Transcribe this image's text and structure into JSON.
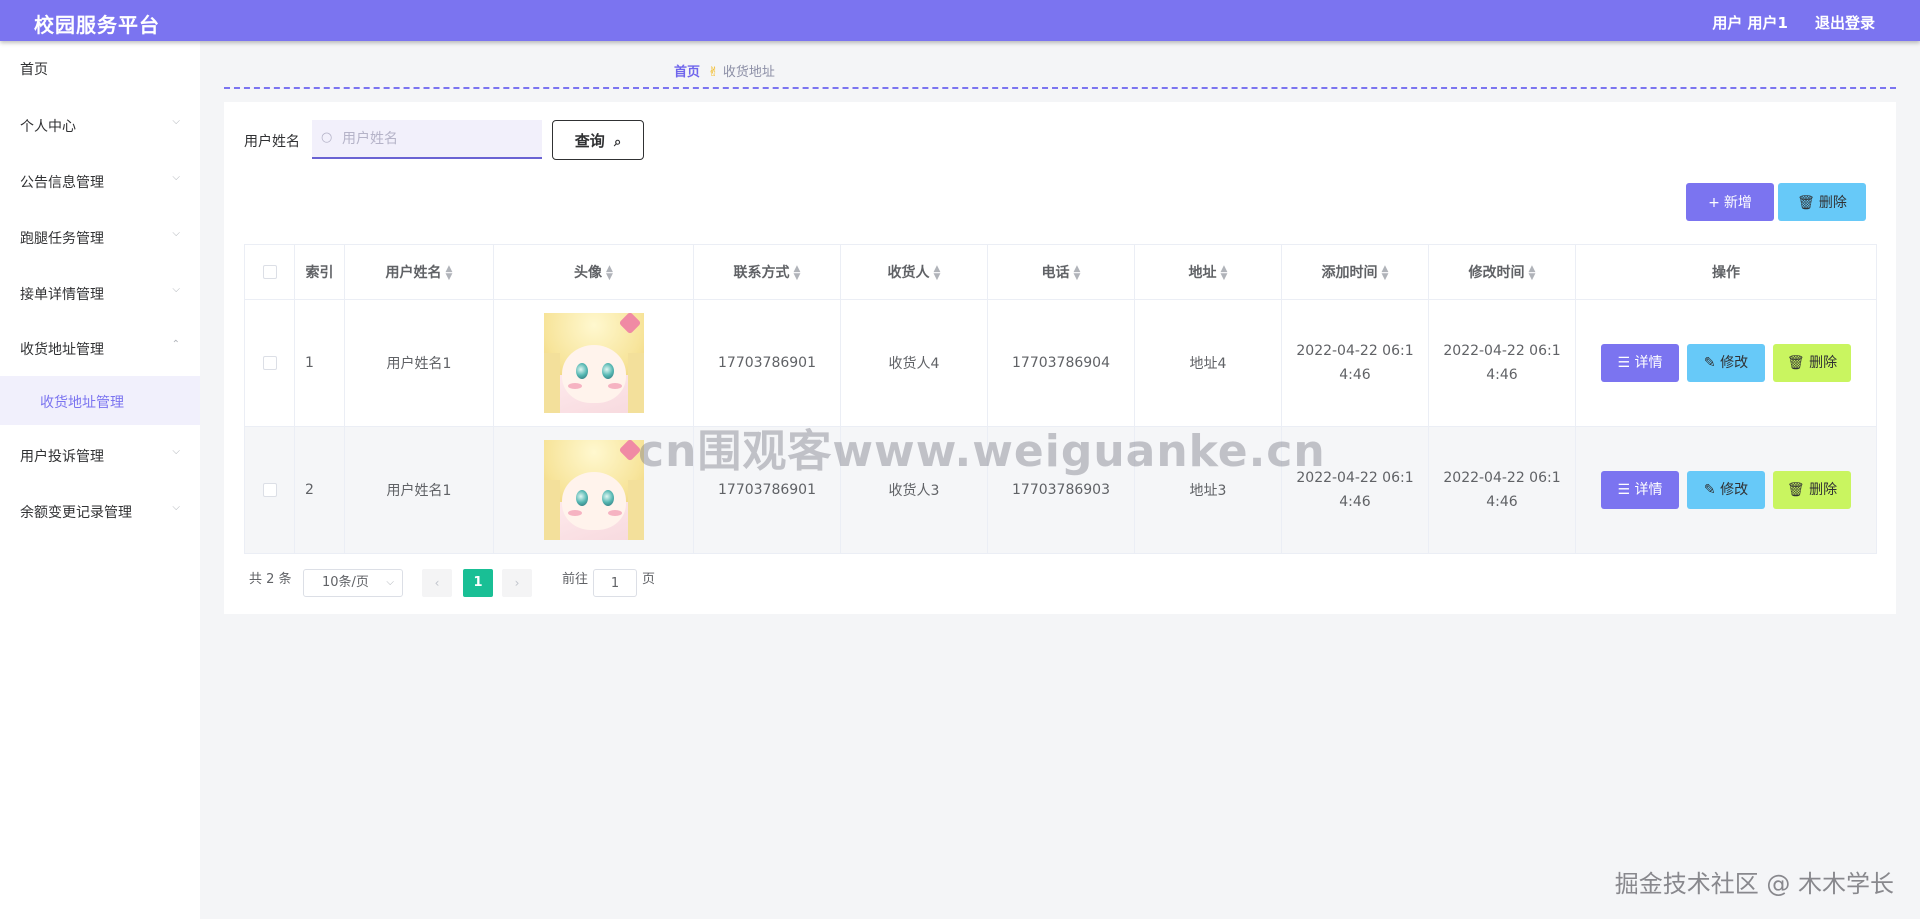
{
  "header": {
    "app_title": "校园服务平台",
    "user_label": "用户 用户1",
    "logout_label": "退出登录"
  },
  "sidebar": {
    "items": [
      {
        "label": "首页",
        "expandable": false
      },
      {
        "label": "个人中心",
        "expandable": true,
        "expanded": false
      },
      {
        "label": "公告信息管理",
        "expandable": true,
        "expanded": false
      },
      {
        "label": "跑腿任务管理",
        "expandable": true,
        "expanded": false
      },
      {
        "label": "接单详情管理",
        "expandable": true,
        "expanded": false
      },
      {
        "label": "收货地址管理",
        "expandable": true,
        "expanded": true
      },
      {
        "label": "用户投诉管理",
        "expandable": true,
        "expanded": false
      },
      {
        "label": "余额变更记录管理",
        "expandable": true,
        "expanded": false
      }
    ],
    "active_subitem": "收货地址管理"
  },
  "breadcrumb": {
    "home": "首页",
    "current": "收货地址"
  },
  "search": {
    "label": "用户姓名",
    "placeholder": "用户姓名",
    "value": "",
    "query_label": "查询"
  },
  "toolbar": {
    "add_label": "新增",
    "delete_label": "删除"
  },
  "table": {
    "columns": [
      "索引",
      "用户姓名",
      "头像",
      "联系方式",
      "收货人",
      "电话",
      "地址",
      "添加时间",
      "修改时间",
      "操作"
    ],
    "rows": [
      {
        "index": "1",
        "username": "用户姓名1",
        "contact": "17703786901",
        "receiver": "收货人4",
        "phone": "17703786904",
        "address": "地址4",
        "created": "2022-04-22 06:14:46",
        "modified": "2022-04-22 06:14:46"
      },
      {
        "index": "2",
        "username": "用户姓名1",
        "contact": "17703786901",
        "receiver": "收货人3",
        "phone": "17703786903",
        "address": "地址3",
        "created": "2022-04-22 06:14:46",
        "modified": "2022-04-22 06:14:46"
      }
    ],
    "actions": {
      "detail": "详情",
      "edit": "修改",
      "delete": "删除"
    }
  },
  "pagination": {
    "total_label": "共 2 条",
    "page_size": "10条/页",
    "current_page": "1",
    "goto_prefix": "前往",
    "goto_value": "1",
    "goto_suffix": "页"
  },
  "watermarks": {
    "center": "cn围观客www.weiguanke.cn",
    "corner": "掘金技术社区 @ 木木学长"
  },
  "colors": {
    "header_bg": "#7b74f0",
    "accent": "#7b74f0",
    "info": "#67c9f8",
    "lime": "#c9f560",
    "page_active": "#19bf95"
  }
}
